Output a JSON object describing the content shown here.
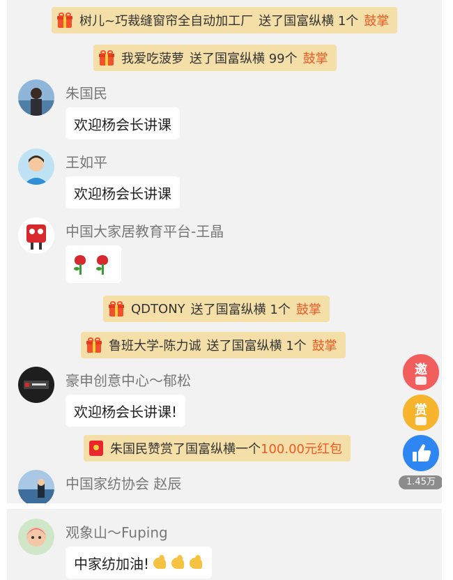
{
  "gift_notices": [
    {
      "sender": "树儿~巧裁缝窗帘全自动加工厂",
      "text": "送了国富纵横 1个",
      "action": "鼓掌"
    },
    {
      "sender": "我爱吃菠萝",
      "text": "送了国富纵横 99个",
      "action": "鼓掌"
    },
    {
      "sender": "QDTONY",
      "text": "送了国富纵横 1个",
      "action": "鼓掌"
    },
    {
      "sender": "鲁班大学-陈力诚",
      "text": "送了国富纵横 1个",
      "action": "鼓掌"
    }
  ],
  "redpacket_notice": {
    "text": "朱国民赞赏了国富纵横一个",
    "amount": "100.00元红包"
  },
  "messages": [
    {
      "name": "朱国民",
      "text": "欢迎杨会长讲课"
    },
    {
      "name": "王如平",
      "text": "欢迎杨会长讲课"
    },
    {
      "name": "中国大家居教育平台-王晶",
      "text": ""
    },
    {
      "name": "豪申创意中心～郁松",
      "text": "欢迎杨会长讲课!"
    },
    {
      "name": "中国家纺协会 赵辰",
      "text": ""
    },
    {
      "name": "观象山～Fuping",
      "text": "中家纺加油!"
    }
  ],
  "side_buttons": {
    "invite": "邀",
    "reward": "赏",
    "like_count": "1.45万"
  },
  "colors": {
    "notice_bg": "#f5dfa8",
    "accent": "#f05a22",
    "like_blue": "#2d86f2"
  },
  "icons": [
    "gift-icon",
    "red-packet-icon",
    "rose-emoji-icon",
    "flexed-biceps-emoji-icon",
    "thumbs-up-icon"
  ]
}
